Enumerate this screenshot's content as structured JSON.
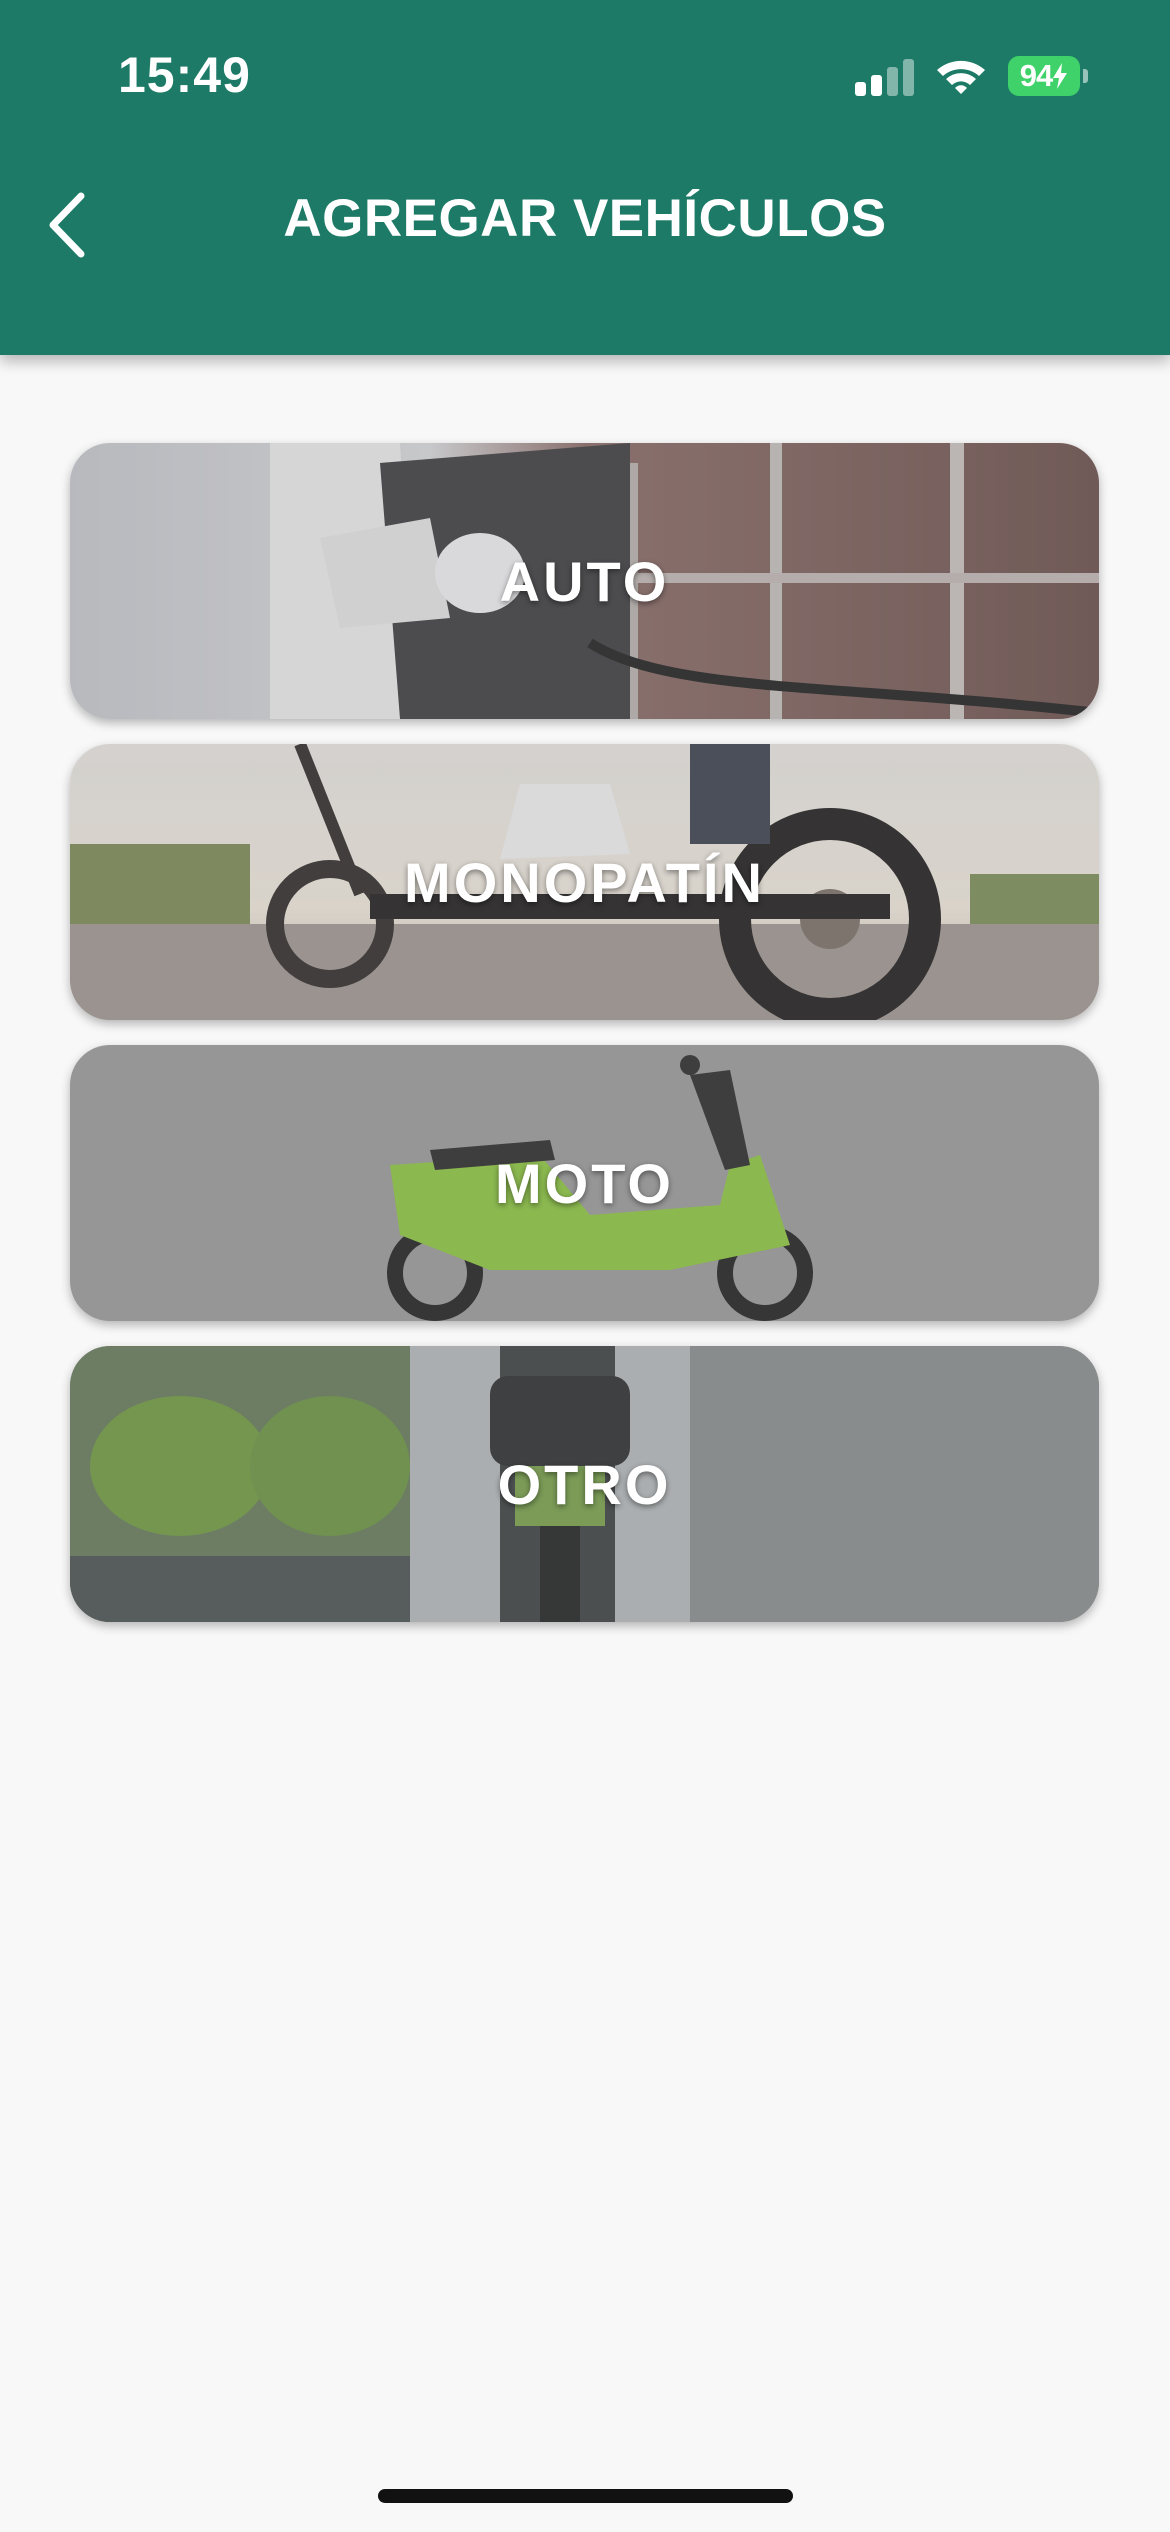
{
  "status_bar": {
    "time": "15:49",
    "battery": "94",
    "battery_color": "#3fd26b",
    "icons": [
      "cellular-signal-icon",
      "wifi-icon",
      "battery-charging-icon"
    ]
  },
  "header": {
    "title": "AGREGAR VEHÍCULOS",
    "background_color": "#1c7a66",
    "back_icon": "chevron-left-icon"
  },
  "vehicles": [
    {
      "label": "AUTO",
      "image": "electric-car-charging-photo"
    },
    {
      "label": "MONOPATÍN",
      "image": "electric-scooter-photo"
    },
    {
      "label": "MOTO",
      "image": "green-electric-motorcycle-photo"
    },
    {
      "label": "OTRO",
      "image": "charging-connector-photo"
    }
  ],
  "colors": {
    "page_background": "#f8f8f8",
    "label_text": "#ffffff",
    "moto_accent": "#8cc63f"
  }
}
